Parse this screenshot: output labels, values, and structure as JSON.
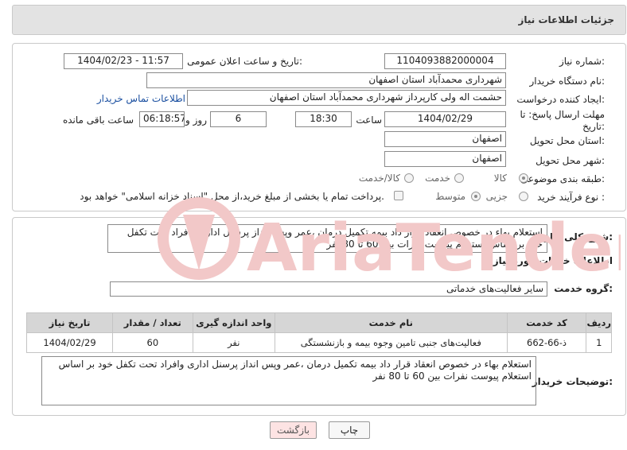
{
  "header": {
    "title": "جزئیات اطلاعات نیاز"
  },
  "form": {
    "need_number_label": "شماره نیاز:",
    "need_number": "1104093882000004",
    "announce_label": "تاریخ و ساعت اعلان عمومی:",
    "announce_value": "1404/02/23 - 11:57",
    "buyer_org_label": "نام دستگاه خریدار:",
    "buyer_org": "شهرداری محمدآباد استان اصفهان",
    "requester_label": "ایجاد کننده درخواست:",
    "requester": "حشمت اله ولی کارپرداز شهرداری محمدآباد استان اصفهان",
    "contact_link": "اطلاعات تماس خریدار",
    "deadline_label": "مهلت ارسال پاسخ: تا تاریخ:",
    "deadline_date": "1404/02/29",
    "time_label": "ساعت",
    "deadline_time": "18:30",
    "days_value": "6",
    "days_label": "روز و",
    "remaining_time": "06:18:57",
    "remaining_label": "ساعت باقی مانده",
    "province_label": "استان محل تحویل:",
    "province": "اصفهان",
    "city_label": "شهر محل تحویل:",
    "city": "اصفهان",
    "category_label": "طبقه بندی موضوعی:",
    "category_options": [
      "کالا",
      "خدمت",
      "کالا/خدمت"
    ],
    "process_label": "نوع فرآیند خرید :",
    "process_options": [
      "جزیی",
      "متوسط"
    ],
    "payment_note": "پرداخت تمام یا بخشی از مبلغ خرید،از محل \"اسناد خزانه اسلامی\" خواهد بود."
  },
  "summary": {
    "label": "شرح کلی نیاز:",
    "text": "استعلام بهاء در خصوص انعقاد قرار داد بیمه تکمیل درمان ،عمر وپس انداز پرسنل اداری وافراد تحت تکفل خود بر اساس استعلام پیوست نفرات بین 60 تا 80 نفر"
  },
  "services": {
    "section_title": "اطلاعات خدمات مورد نیاز",
    "group_label": "گروه خدمت:",
    "group_value": "سایر فعالیت‌های خدماتی",
    "columns": [
      "ردیف",
      "کد خدمت",
      "نام خدمت",
      "واحد اندازه گیری",
      "تعداد / مقدار",
      "تاریخ نیاز"
    ],
    "rows": [
      [
        "1",
        "ذ-66-662",
        "فعالیت‌های جنبی تامین وجوه بیمه و بازنشستگی",
        "نفر",
        "60",
        "1404/02/29"
      ]
    ]
  },
  "buyer_notes": {
    "label": "توضیحات خریدار:",
    "text": "استعلام بهاء در خصوص انعقاد قرار داد بیمه تکمیل درمان ،عمر وپس انداز پرسنل اداری وافراد تحت تکفل خود بر اساس استعلام پیوست نفرات بین 60 تا 80 نفر"
  },
  "buttons": {
    "print": "چاپ",
    "back": "بازگشت"
  },
  "watermark": {
    "text": "AriaTender.neT"
  },
  "colors": {
    "link": "#1a4fa0",
    "back_button_bg": "#fde3e3",
    "header_bg": "#e3e3e3",
    "watermark": "#f2c8c8"
  }
}
